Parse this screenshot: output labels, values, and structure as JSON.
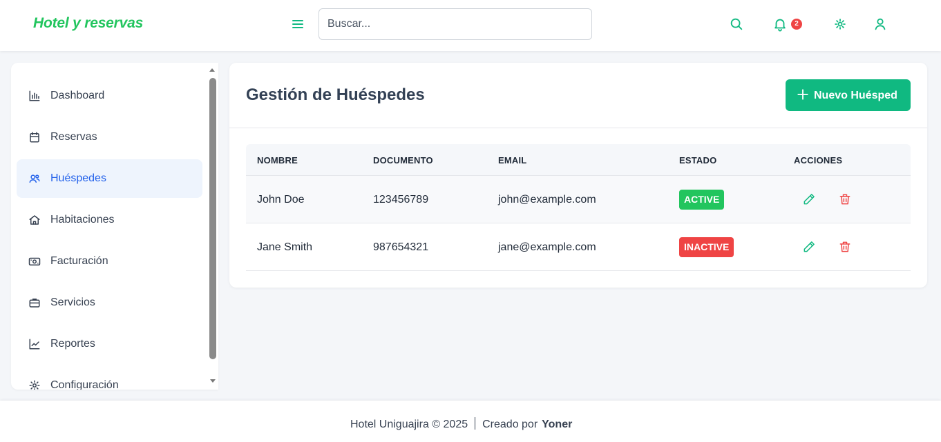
{
  "header": {
    "brand": "Hotel y reservas",
    "search_placeholder": "Buscar...",
    "notification_count": "2",
    "accent_color": "#22c55e",
    "icons": [
      "menu-icon",
      "search-icon",
      "bell-icon",
      "gear-icon",
      "user-icon"
    ]
  },
  "sidebar": {
    "items": [
      {
        "label": "Dashboard",
        "icon": "chart-icon",
        "active": false
      },
      {
        "label": "Reservas",
        "icon": "calendar-icon",
        "active": false
      },
      {
        "label": "Huéspedes",
        "icon": "users-icon",
        "active": true
      },
      {
        "label": "Habitaciones",
        "icon": "home-icon",
        "active": false
      },
      {
        "label": "Facturación",
        "icon": "cash-icon",
        "active": false
      },
      {
        "label": "Servicios",
        "icon": "briefcase-icon",
        "active": false
      },
      {
        "label": "Reportes",
        "icon": "trend-icon",
        "active": false
      },
      {
        "label": "Configuración",
        "icon": "gear-icon",
        "active": false
      }
    ]
  },
  "main": {
    "title": "Gestión de Huéspedes",
    "new_button": "Nuevo Huésped",
    "table": {
      "headers": [
        "NOMBRE",
        "DOCUMENTO",
        "EMAIL",
        "ESTADO",
        "ACCIONES"
      ],
      "rows": [
        {
          "name": "John Doe",
          "document": "123456789",
          "email": "john@example.com",
          "status": "ACTIVE",
          "status_color": "#22c55e"
        },
        {
          "name": "Jane Smith",
          "document": "987654321",
          "email": "jane@example.com",
          "status": "INACTIVE",
          "status_color": "#ef4444"
        }
      ]
    }
  },
  "footer": {
    "copyright": "Hotel Uniguajira © 2025",
    "created_by": "Creado por",
    "author": "Yoner"
  }
}
